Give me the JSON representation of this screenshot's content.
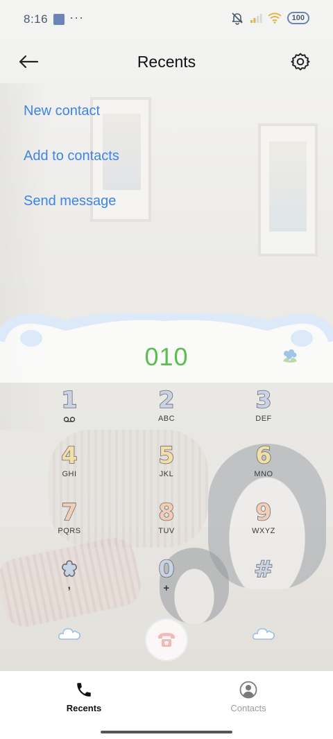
{
  "status_bar": {
    "time": "8:16",
    "dots": "···",
    "battery": "100"
  },
  "header": {
    "title": "Recents"
  },
  "actions": [
    {
      "label": "New contact"
    },
    {
      "label": "Add to contacts"
    },
    {
      "label": "Send message"
    }
  ],
  "dialer": {
    "number": "010",
    "keys": [
      {
        "digit": "1",
        "letters": "",
        "color": "#c9d3e6"
      },
      {
        "digit": "2",
        "letters": "ABC",
        "color": "#c9d3e6"
      },
      {
        "digit": "3",
        "letters": "DEF",
        "color": "#c9d3e6"
      },
      {
        "digit": "4",
        "letters": "GHI",
        "color": "#f2dfa8"
      },
      {
        "digit": "5",
        "letters": "JKL",
        "color": "#f2dfa8"
      },
      {
        "digit": "6",
        "letters": "MNO",
        "color": "#f2dfa8"
      },
      {
        "digit": "7",
        "letters": "PQRS",
        "color": "#f1cfb6"
      },
      {
        "digit": "8",
        "letters": "TUV",
        "color": "#f1cfb6"
      },
      {
        "digit": "9",
        "letters": "WXYZ",
        "color": "#f1cfb6"
      },
      {
        "digit": "",
        "letters": ",",
        "color": "#c9d3e6"
      },
      {
        "digit": "0",
        "letters": "+",
        "color": "#c9d3e6"
      },
      {
        "digit": "#",
        "letters": "",
        "color": "#c9d3e6"
      }
    ]
  },
  "bottom_nav": {
    "tabs": [
      {
        "label": "Recents",
        "active": true
      },
      {
        "label": "Contacts",
        "active": false
      }
    ]
  },
  "colors": {
    "accent_link": "#3d84e6",
    "number_green": "#5bbd4d",
    "panel_blue": "#dbe9f8"
  }
}
